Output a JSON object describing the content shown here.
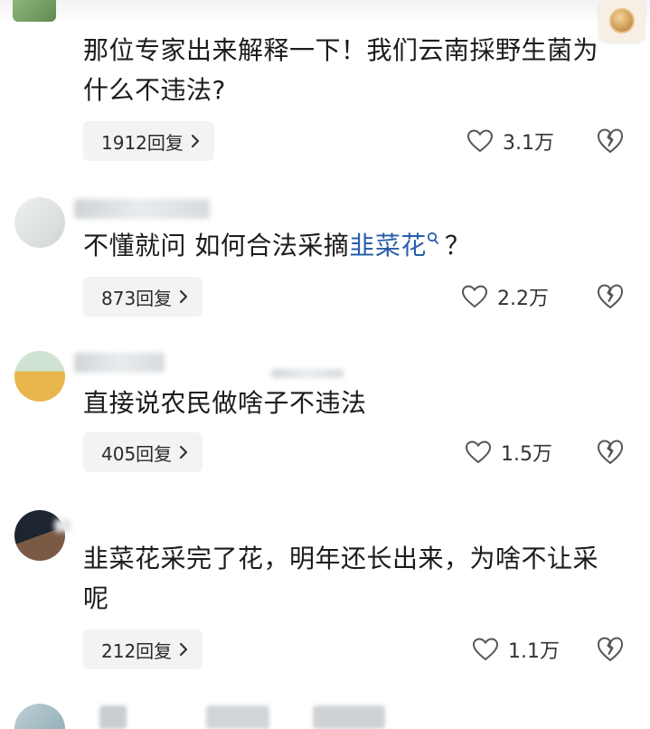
{
  "comments": [
    {
      "text": "那位专家出来解释一下！我们云南採野生菌为什么不违法?",
      "replies": "1912回复",
      "likes": "3.1万"
    },
    {
      "text_before": "不懂就问 如何合法采摘",
      "keyword": "韭菜花",
      "text_after": "？",
      "replies": "873回复",
      "likes": "2.2万"
    },
    {
      "text": "直接说农民做啥子不违法",
      "replies": "405回复",
      "likes": "1.5万"
    },
    {
      "text": "韭菜花采完了花，明年还长出来，为啥不让采呢",
      "replies": "212回复",
      "likes": "1.1万"
    }
  ],
  "icons": {
    "like": "heart-outline-icon",
    "dislike": "broken-heart-icon",
    "reply_chevron": "chevron-right-icon",
    "keyword_search": "search-icon"
  },
  "colors": {
    "keyword": "#2a5fa8",
    "reply_pill_bg": "#f2f3f5",
    "text": "#1b1b1b"
  }
}
